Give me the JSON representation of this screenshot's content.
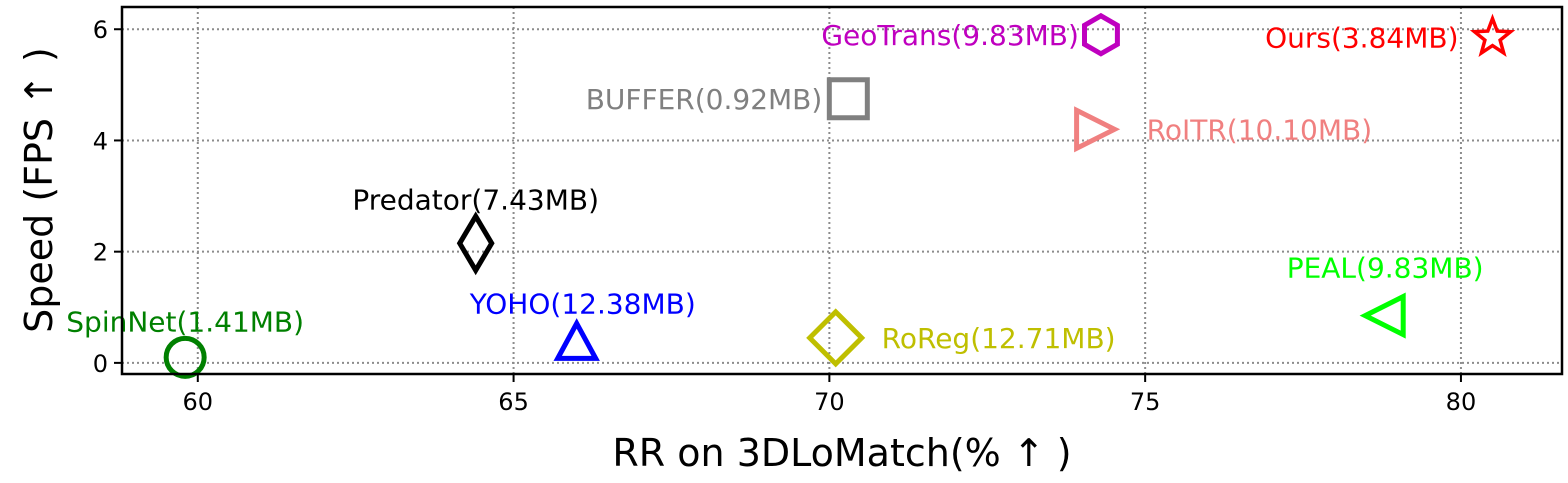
{
  "chart_data": {
    "type": "scatter",
    "title": "",
    "xlabel": "RR on 3DLoMatch(% ↑ )",
    "ylabel": "Speed (FPS ↑ )",
    "xlim": [
      58.8,
      81.6
    ],
    "ylim": [
      -0.2,
      6.4
    ],
    "xticks": [
      60,
      65,
      70,
      75,
      80
    ],
    "yticks": [
      0,
      2,
      4,
      6
    ],
    "grid": true,
    "points": [
      {
        "label": "SpinNet(1.41MB)",
        "x": 59.8,
        "y": 0.1,
        "marker": "circle",
        "color": "#008000"
      },
      {
        "label": "YOHO(12.38MB)",
        "x": 66.0,
        "y": 0.35,
        "marker": "triangle-up",
        "color": "#0000ff"
      },
      {
        "label": "Predator(7.43MB)",
        "x": 64.4,
        "y": 2.15,
        "marker": "thin-diamond",
        "color": "#000000"
      },
      {
        "label": "RoReg(12.71MB)",
        "x": 70.1,
        "y": 0.45,
        "marker": "diamond",
        "color": "#bfbf00"
      },
      {
        "label": "BUFFER(0.92MB)",
        "x": 70.3,
        "y": 4.75,
        "marker": "square",
        "color": "#808080"
      },
      {
        "label": "RoITR(10.10MB)",
        "x": 74.2,
        "y": 4.2,
        "marker": "triangle-right",
        "color": "#f08080"
      },
      {
        "label": "GeoTrans(9.83MB)",
        "x": 74.3,
        "y": 5.9,
        "marker": "hexagon",
        "color": "#bf00bf"
      },
      {
        "label": "PEAL(9.83MB)",
        "x": 78.8,
        "y": 0.85,
        "marker": "triangle-left",
        "color": "#00ff00"
      },
      {
        "label": "Ours(3.84MB)",
        "x": 80.5,
        "y": 5.85,
        "marker": "star",
        "color": "#ff0000"
      }
    ]
  }
}
